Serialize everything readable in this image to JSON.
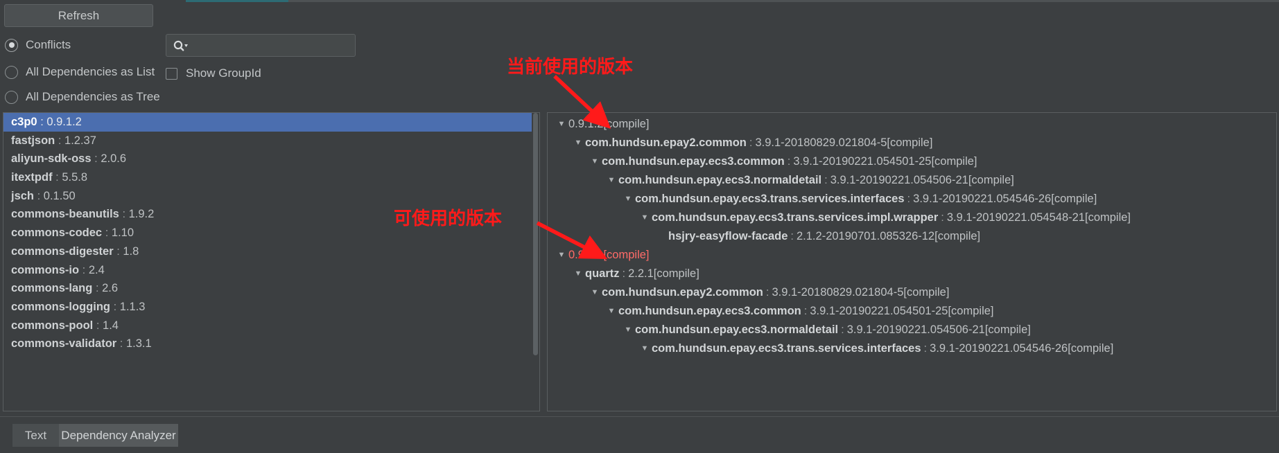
{
  "toolbar": {
    "refresh_label": "Refresh",
    "radios": [
      {
        "label": "Conflicts",
        "checked": true
      },
      {
        "label": "All Dependencies as List",
        "checked": false
      },
      {
        "label": "All Dependencies as Tree",
        "checked": false
      }
    ],
    "search": {
      "value": "",
      "placeholder": "",
      "icon": "search-icon"
    },
    "checkbox": {
      "label": "Show GroupId",
      "checked": false
    }
  },
  "dependency_list": {
    "selected_index": 0,
    "items": [
      {
        "artifact": "c3p0",
        "version": "0.9.1.2"
      },
      {
        "artifact": "fastjson",
        "version": "1.2.37"
      },
      {
        "artifact": "aliyun-sdk-oss",
        "version": "2.0.6"
      },
      {
        "artifact": "itextpdf",
        "version": "5.5.8"
      },
      {
        "artifact": "jsch",
        "version": "0.1.50"
      },
      {
        "artifact": "commons-beanutils",
        "version": "1.9.2"
      },
      {
        "artifact": "commons-codec",
        "version": "1.10"
      },
      {
        "artifact": "commons-digester",
        "version": "1.8"
      },
      {
        "artifact": "commons-io",
        "version": "2.4"
      },
      {
        "artifact": "commons-lang",
        "version": "2.6"
      },
      {
        "artifact": "commons-logging",
        "version": "1.1.3"
      },
      {
        "artifact": "commons-pool",
        "version": "1.4"
      },
      {
        "artifact": "commons-validator",
        "version": "1.3.1"
      }
    ]
  },
  "dependency_tree": {
    "rows": [
      {
        "depth": 0,
        "expanded": true,
        "artifact": "",
        "version": "0.9.1.2",
        "scope": "[compile]",
        "conflict": false
      },
      {
        "depth": 1,
        "expanded": true,
        "artifact": "com.hundsun.epay2.common",
        "version": "3.9.1-20180829.021804-5",
        "scope": "[compile]",
        "conflict": false
      },
      {
        "depth": 2,
        "expanded": true,
        "artifact": "com.hundsun.epay.ecs3.common",
        "version": "3.9.1-20190221.054501-25",
        "scope": "[compile]",
        "conflict": false
      },
      {
        "depth": 3,
        "expanded": true,
        "artifact": "com.hundsun.epay.ecs3.normaldetail",
        "version": "3.9.1-20190221.054506-21",
        "scope": "[compile]",
        "conflict": false
      },
      {
        "depth": 4,
        "expanded": true,
        "artifact": "com.hundsun.epay.ecs3.trans.services.interfaces",
        "version": "3.9.1-20190221.054546-26",
        "scope": "[compile]",
        "conflict": false
      },
      {
        "depth": 5,
        "expanded": true,
        "artifact": "com.hundsun.epay.ecs3.trans.services.impl.wrapper",
        "version": "3.9.1-20190221.054548-21",
        "scope": "[compile]",
        "conflict": false
      },
      {
        "depth": 6,
        "expanded": false,
        "artifact": "hsjry-easyflow-facade",
        "version": "2.1.2-20190701.085326-12",
        "scope": "[compile]",
        "conflict": false
      },
      {
        "depth": 0,
        "expanded": true,
        "artifact": "",
        "version": "0.9.1.1",
        "scope": "[compile]",
        "conflict": true
      },
      {
        "depth": 1,
        "expanded": true,
        "artifact": "quartz",
        "version": "2.2.1",
        "scope": "[compile]",
        "conflict": false
      },
      {
        "depth": 2,
        "expanded": true,
        "artifact": "com.hundsun.epay2.common",
        "version": "3.9.1-20180829.021804-5",
        "scope": "[compile]",
        "conflict": false
      },
      {
        "depth": 3,
        "expanded": true,
        "artifact": "com.hundsun.epay.ecs3.common",
        "version": "3.9.1-20190221.054501-25",
        "scope": "[compile]",
        "conflict": false
      },
      {
        "depth": 4,
        "expanded": true,
        "artifact": "com.hundsun.epay.ecs3.normaldetail",
        "version": "3.9.1-20190221.054506-21",
        "scope": "[compile]",
        "conflict": false
      },
      {
        "depth": 5,
        "expanded": true,
        "artifact": "com.hundsun.epay.ecs3.trans.services.interfaces",
        "version": "3.9.1-20190221.054546-26",
        "scope": "[compile]",
        "conflict": false
      }
    ]
  },
  "annotations": {
    "current_version_note": "当前使用的版本",
    "available_version_note": "可使用的版本",
    "color": "#ff1a1a"
  },
  "bottom_tabs": {
    "items": [
      {
        "label": "Text",
        "active": false
      },
      {
        "label": "Dependency Analyzer",
        "active": true
      }
    ]
  }
}
